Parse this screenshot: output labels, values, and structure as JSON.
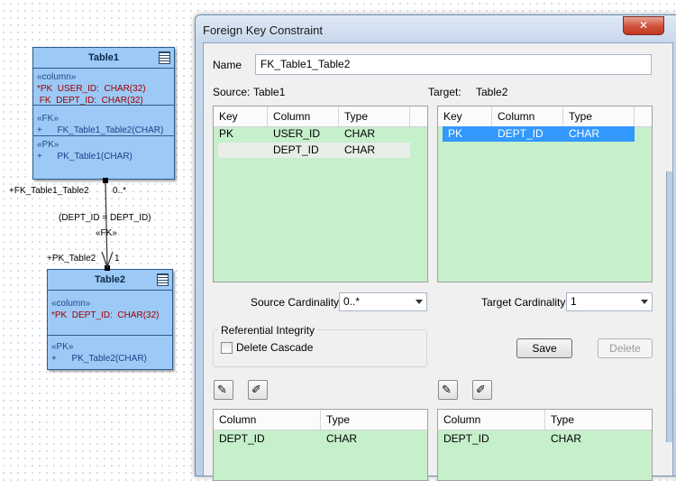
{
  "diagram": {
    "table1": {
      "name": "Table1",
      "stereo_column": "«column»",
      "columns": [
        "*PK  USER_ID:  CHAR(32)",
        " FK  DEPT_ID:  CHAR(32)"
      ],
      "stereo_fk": "«FK»",
      "fk_op": "+      FK_Table1_Table2(CHAR)",
      "stereo_pk": "«PK»",
      "pk_op": "+      PK_Table1(CHAR)"
    },
    "table2": {
      "name": "Table2",
      "stereo_column": "«column»",
      "columns": [
        "*PK  DEPT_ID:  CHAR(32)"
      ],
      "stereo_pk": "«PK»",
      "pk_op": "+      PK_Table2(CHAR)"
    },
    "relation": {
      "source_role": "+FK_Table1_Table2",
      "source_mult": "0..*",
      "condition": "(DEPT_ID = DEPT_ID)",
      "stereotype": "«FK»",
      "target_role": "+PK_Table2",
      "target_mult": "1"
    }
  },
  "dialog": {
    "title": "Foreign Key Constraint",
    "close_glyph": "✕",
    "name_label": "Name",
    "name_value": "FK_Table1_Table2",
    "source_label": "Source:",
    "source_value": "Table1",
    "target_label": "Target:",
    "target_value": "Table2",
    "source_grid": {
      "headers": [
        "Key",
        "Column",
        "Type"
      ],
      "rows": [
        {
          "key": "PK",
          "column": "USER_ID",
          "type": "CHAR"
        },
        {
          "key": "",
          "column": "DEPT_ID",
          "type": "CHAR"
        }
      ]
    },
    "target_grid": {
      "headers": [
        "Key",
        "Column",
        "Type"
      ],
      "rows": [
        {
          "key": "PK",
          "column": "DEPT_ID",
          "type": "CHAR"
        }
      ]
    },
    "source_cardinality_label": "Source Cardinality:",
    "source_cardinality_value": "0..*",
    "target_cardinality_label": "Target Cardinality:",
    "target_cardinality_value": "1",
    "ref_integrity_label": "Referential Integrity",
    "delete_cascade_label": "Delete Cascade",
    "delete_cascade_checked": false,
    "save_label": "Save",
    "delete_label": "Delete",
    "bottom_left_grid": {
      "headers": [
        "Column",
        "Type"
      ],
      "rows": [
        {
          "column": "DEPT_ID",
          "type": "CHAR"
        }
      ]
    },
    "bottom_right_grid": {
      "headers": [
        "Column",
        "Type"
      ],
      "rows": [
        {
          "column": "DEPT_ID",
          "type": "CHAR"
        }
      ]
    },
    "icons": {
      "move_up": "pencil-up-icon",
      "move_down": "pencil-down-icon",
      "glyph_a": "✎",
      "glyph_b": "✐"
    }
  }
}
